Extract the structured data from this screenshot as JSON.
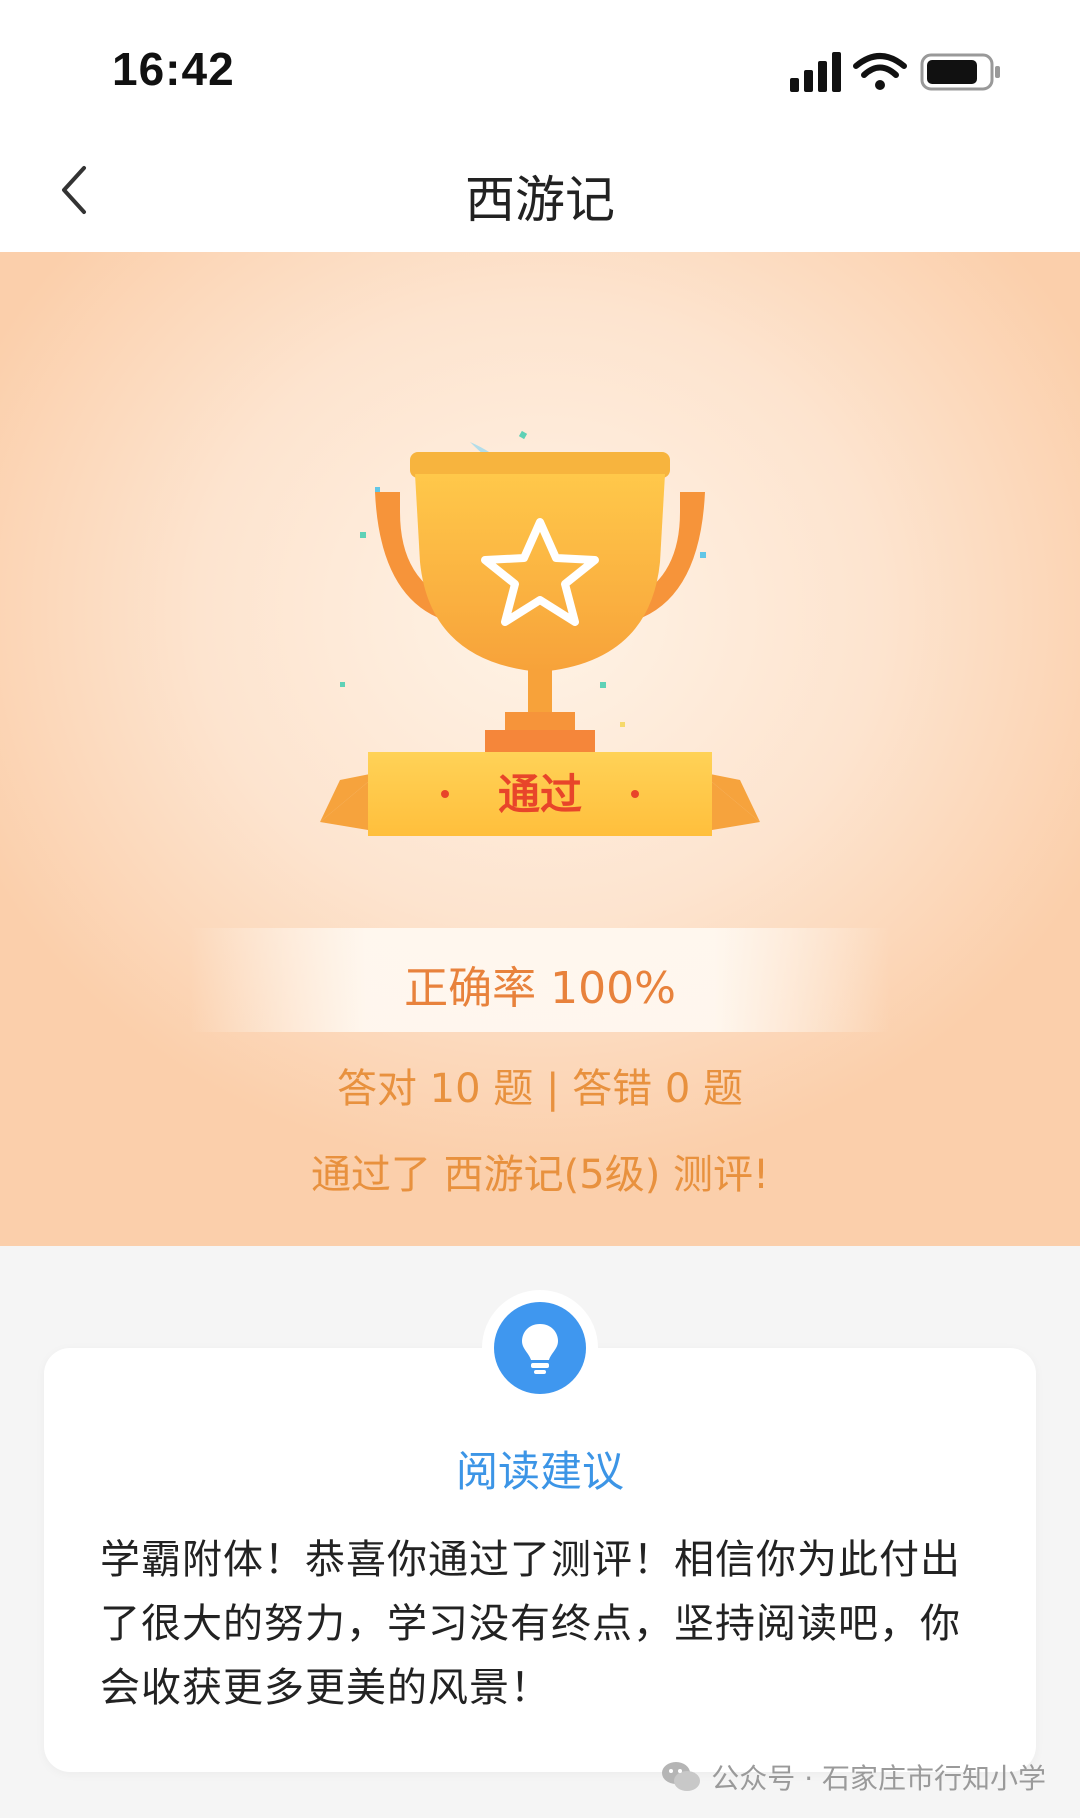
{
  "status_bar": {
    "time": "16:42",
    "icons": [
      "signal-icon",
      "wifi-icon",
      "battery-icon"
    ]
  },
  "nav": {
    "title": "西游记",
    "back_icon": "chevron-left-icon"
  },
  "result": {
    "badge_label": "通过",
    "accuracy": "正确率 100%",
    "counts": "答对 10 题 | 答错 0 题",
    "passed_message": "通过了 西游记(5级) 测评!"
  },
  "advice": {
    "icon": "lightbulb-icon",
    "title": "阅读建议",
    "body": "学霸附体！恭喜你通过了测评！相信你为此付出了很大的努力，学习没有终点，坚持阅读吧，你会收获更多更美的风景！"
  },
  "watermark": {
    "text": "公众号 · 石家庄市行知小学",
    "icon": "wechat-icon"
  },
  "colors": {
    "accent_orange": "#e8823c",
    "accent_blue": "#3f97ef",
    "badge_text_red": "#e8452a"
  }
}
